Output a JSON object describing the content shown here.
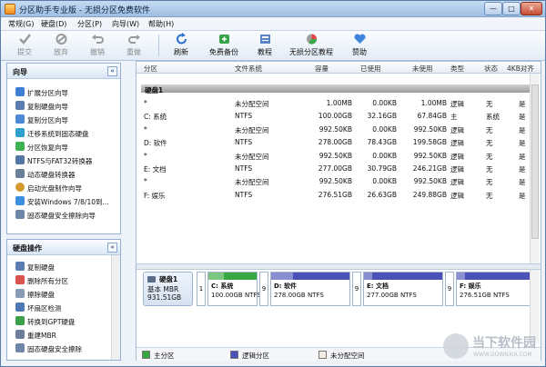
{
  "window": {
    "title": "分区助手专业版 - 无损分区免费软件",
    "controls": {
      "minimize": "—",
      "maximize": "□",
      "close": "✕"
    }
  },
  "menu": [
    "常规(G)",
    "硬盘(D)",
    "分区(P)",
    "向导(W)",
    "帮助(H)"
  ],
  "toolbar": {
    "submit": "提交",
    "discard": "放弃",
    "undo": "撤销",
    "redo": "重做",
    "refresh": "刷新",
    "backup": "免费备份",
    "tutorial": "教程",
    "lossless": "无损分区教程",
    "sponsor": "赞助"
  },
  "wizard_panel": {
    "title": "向导",
    "collapse": "«",
    "items": [
      {
        "label": "扩展分区向导",
        "icon": "extend-partition-icon"
      },
      {
        "label": "复制硬盘向导",
        "icon": "copy-disk-icon"
      },
      {
        "label": "复制分区向导",
        "icon": "copy-partition-icon"
      },
      {
        "label": "迁移系统到固态硬盘",
        "icon": "migrate-os-icon"
      },
      {
        "label": "分区恢复向导",
        "icon": "partition-recovery-icon"
      },
      {
        "label": "NTFS与FAT32转换器",
        "icon": "ntfs-fat32-converter-icon"
      },
      {
        "label": "动态硬盘转换器",
        "icon": "dynamic-disk-converter-icon"
      },
      {
        "label": "启动光盘制作向导",
        "icon": "boot-disc-icon"
      },
      {
        "label": "安装Windows 7/8/10到...",
        "icon": "windows-install-icon"
      },
      {
        "label": "固态硬盘安全擦除向导",
        "icon": "ssd-erase-icon"
      }
    ]
  },
  "disk_ops_panel": {
    "title": "硬盘操作",
    "collapse": "«",
    "items": [
      {
        "label": "复制硬盘",
        "icon": "copy-disk-icon"
      },
      {
        "label": "删除所有分区",
        "icon": "delete-all-partitions-icon"
      },
      {
        "label": "擦除硬盘",
        "icon": "wipe-disk-icon"
      },
      {
        "label": "坏扇区检测",
        "icon": "bad-sector-check-icon"
      },
      {
        "label": "转换到GPT硬盘",
        "icon": "convert-gpt-icon"
      },
      {
        "label": "重建MBR",
        "icon": "rebuild-mbr-icon"
      },
      {
        "label": "固态硬盘安全擦除",
        "icon": "ssd-erase-icon"
      }
    ]
  },
  "table": {
    "headers": {
      "partition": "分区",
      "fs": "文件系统",
      "capacity": "容量",
      "used": "已使用",
      "unused": "未使用",
      "type": "类型",
      "status": "状态",
      "align": "4KB对齐"
    },
    "disk_label": "硬盘1",
    "rows": [
      {
        "partition": "*",
        "fs": "未分配空间",
        "capacity": "1.00MB",
        "used": "0.00KB",
        "unused": "1.00MB",
        "type": "逻辑",
        "status": "无",
        "align": "是"
      },
      {
        "partition": "C: 系统",
        "fs": "NTFS",
        "capacity": "100.00GB",
        "used": "32.16GB",
        "unused": "67.84GB",
        "type": "主",
        "status": "系统",
        "align": "是"
      },
      {
        "partition": "*",
        "fs": "未分配空间",
        "capacity": "992.50KB",
        "used": "0.00KB",
        "unused": "992.50KB",
        "type": "逻辑",
        "status": "无",
        "align": "是"
      },
      {
        "partition": "D: 软件",
        "fs": "NTFS",
        "capacity": "278.00GB",
        "used": "78.43GB",
        "unused": "199.58GB",
        "type": "逻辑",
        "status": "无",
        "align": "是"
      },
      {
        "partition": "*",
        "fs": "未分配空间",
        "capacity": "992.50KB",
        "used": "0.00KB",
        "unused": "992.50KB",
        "type": "逻辑",
        "status": "无",
        "align": "是"
      },
      {
        "partition": "E: 文档",
        "fs": "NTFS",
        "capacity": "277.00GB",
        "used": "30.79GB",
        "unused": "246.21GB",
        "type": "逻辑",
        "status": "无",
        "align": "是"
      },
      {
        "partition": "*",
        "fs": "未分配空间",
        "capacity": "992.50KB",
        "used": "0.00KB",
        "unused": "992.50KB",
        "type": "逻辑",
        "status": "无",
        "align": "是"
      },
      {
        "partition": "F: 娱乐",
        "fs": "NTFS",
        "capacity": "276.51GB",
        "used": "26.63GB",
        "unused": "249.88GB",
        "type": "逻辑",
        "status": "无",
        "align": "是"
      }
    ]
  },
  "disk_map": {
    "disk": {
      "name": "硬盘1",
      "type": "基本 MBR",
      "size": "931.51GB"
    },
    "partitions": [
      {
        "kind": "slot",
        "label": "1",
        "color": "#ffffff"
      },
      {
        "kind": "part",
        "name": "C: 系统",
        "info": "100.00GB NTFS",
        "color": "#36a83f",
        "fill": 0.32
      },
      {
        "kind": "slot",
        "label": "9",
        "color": "#ffffff"
      },
      {
        "kind": "part",
        "name": "D: 软件",
        "info": "278.00GB NTFS",
        "color": "#4a52b8",
        "fill": 0.28
      },
      {
        "kind": "slot",
        "label": "9",
        "color": "#ffffff"
      },
      {
        "kind": "part",
        "name": "E: 文档",
        "info": "277.00GB NTFS",
        "color": "#4a52b8",
        "fill": 0.11
      },
      {
        "kind": "slot",
        "label": "9",
        "color": "#ffffff"
      },
      {
        "kind": "part",
        "name": "F: 娱乐",
        "info": "276.51GB NTFS",
        "color": "#4a52b8",
        "fill": 0.1
      }
    ]
  },
  "legend": {
    "primary": "主分区",
    "logical": "逻辑分区",
    "unallocated": "未分配空间",
    "colors": {
      "primary": "#36a83f",
      "logical": "#4a52b8",
      "unallocated": "#f0ece0"
    }
  },
  "watermark": {
    "name": "当下软件园",
    "url": "WWW.DOWNXIA.COM"
  }
}
